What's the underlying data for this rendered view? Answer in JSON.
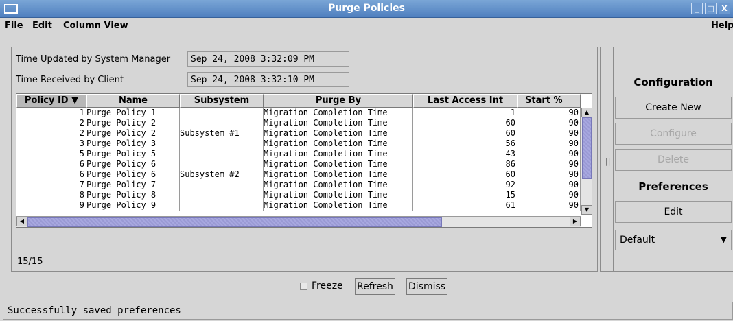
{
  "window": {
    "title": "Purge Policies",
    "controls": [
      "_",
      "□",
      "X"
    ]
  },
  "menubar": {
    "items": [
      "File",
      "Edit",
      "Column View"
    ],
    "help": "Help"
  },
  "info": {
    "updated_label": "Time Updated by System Manager",
    "updated_value": "Sep 24, 2008 3:32:09 PM",
    "received_label": "Time Received by Client",
    "received_value": "Sep 24, 2008 3:32:10 PM"
  },
  "table": {
    "columns": [
      "Policy ID ▼",
      "Name",
      "Subsystem",
      "Purge By",
      "Last Access Int",
      "Start %"
    ],
    "rows": [
      [
        "1",
        "Purge Policy 1",
        "",
        "Migration Completion Time",
        "1",
        "90"
      ],
      [
        "2",
        "Purge Policy 2",
        "",
        "Migration Completion Time",
        "60",
        "90"
      ],
      [
        "2",
        "Purge Policy 2",
        "Subsystem #1",
        "Migration Completion Time",
        "60",
        "90"
      ],
      [
        "3",
        "Purge Policy 3",
        "",
        "Migration Completion Time",
        "56",
        "90"
      ],
      [
        "5",
        "Purge Policy 5",
        "",
        "Migration Completion Time",
        "43",
        "90"
      ],
      [
        "6",
        "Purge Policy 6",
        "",
        "Migration Completion Time",
        "86",
        "90"
      ],
      [
        "6",
        "Purge Policy 6",
        "Subsystem #2",
        "Migration Completion Time",
        "60",
        "90"
      ],
      [
        "7",
        "Purge Policy 7",
        "",
        "Migration Completion Time",
        "92",
        "90"
      ],
      [
        "8",
        "Purge Policy 8",
        "",
        "Migration Completion Time",
        "15",
        "90"
      ],
      [
        "9",
        "Purge Policy 9",
        "",
        "Migration Completion Time",
        "61",
        "90"
      ]
    ],
    "count": "15/15"
  },
  "right_panel": {
    "configuration_label": "Configuration",
    "create_new": "Create New",
    "configure": "Configure",
    "delete": "Delete",
    "preferences_label": "Preferences",
    "edit": "Edit",
    "preferences_selected": "Default"
  },
  "bottom": {
    "freeze_label": "Freeze",
    "refresh": "Refresh",
    "dismiss": "Dismiss"
  },
  "status": {
    "message": "Successfully saved preferences"
  }
}
